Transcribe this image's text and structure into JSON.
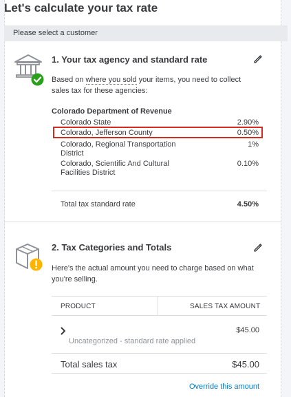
{
  "header": {
    "title": "Let's calculate your tax rate"
  },
  "customer_bar": {
    "text": "Please select a customer"
  },
  "agency_section": {
    "title": "1. Your tax agency and standard rate",
    "desc_before": "Based on ",
    "desc_link": "where you sold",
    "desc_after": " your items, you need to collect",
    "desc_line2": "sales tax for these agencies:",
    "agency_name": "Colorado Department of Revenue",
    "rates": [
      {
        "name": "Colorado State",
        "value": "2.90%"
      },
      {
        "name": "Colorado, Jefferson County",
        "value": "0.50%"
      },
      {
        "name": "Colorado, Regional Transportation District",
        "value": "1%"
      },
      {
        "name": "Colorado, Scientific And Cultural Facilities District",
        "value": "0.10%"
      }
    ],
    "total_label": "Total tax standard rate",
    "total_value": "4.50%"
  },
  "categories_section": {
    "title": "2. Tax Categories and Totals",
    "desc_line1": "Here's the actual amount you need to charge based on what",
    "desc_line2": "you're selling.",
    "col_product": "PRODUCT",
    "col_sales_tax": "SALES TAX AMOUNT",
    "row_amount": "$45.00",
    "row_note": "Uncategorized - standard rate applied",
    "total_label": "Total sales tax",
    "total_value": "$45.00",
    "override_link": "Override this amount"
  },
  "icons": {
    "agency": "bank-building-icon",
    "agency_status": "check-circle-icon",
    "categories": "box-icon",
    "categories_status": "warning-circle-icon",
    "edit": "pencil-icon",
    "expand": "chevron-right-icon"
  },
  "colors": {
    "success": "#2ca01c",
    "warning": "#ffb400",
    "link": "#0077c5",
    "highlight": "#d52b1e"
  }
}
